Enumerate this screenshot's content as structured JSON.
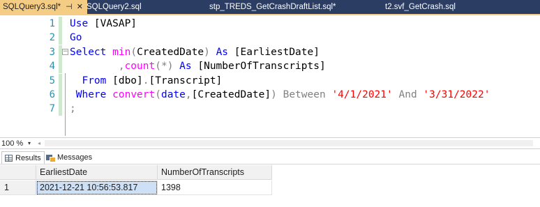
{
  "tabs": [
    {
      "label": "SQLQuery3.sql*",
      "pin": "⊣",
      "close": "✕"
    },
    {
      "label": "SQLQuery2.sql"
    },
    {
      "label": "stp_TREDS_GetCrashDraftList.sql*"
    },
    {
      "label": "t2.svf_GetCrash.sql"
    }
  ],
  "editor": {
    "line_numbers": [
      "1",
      "2",
      "3",
      "4",
      "5",
      "6",
      "7"
    ],
    "fold_marker": "−",
    "lines": [
      {
        "tokens": [
          {
            "c": "kw",
            "t": "Use"
          },
          {
            "c": "tx",
            "t": " [VASAP]"
          }
        ]
      },
      {
        "tokens": [
          {
            "c": "kw",
            "t": "Go"
          }
        ]
      },
      {
        "tokens": [
          {
            "c": "kw",
            "t": "Select"
          },
          {
            "c": "tx",
            "t": " "
          },
          {
            "c": "fn",
            "t": "min"
          },
          {
            "c": "gr",
            "t": "("
          },
          {
            "c": "tx",
            "t": "CreatedDate"
          },
          {
            "c": "gr",
            "t": ")"
          },
          {
            "c": "tx",
            "t": " "
          },
          {
            "c": "kw",
            "t": "As"
          },
          {
            "c": "tx",
            "t": " [EarliestDate]"
          }
        ]
      },
      {
        "tokens": [
          {
            "c": "tx",
            "t": "        "
          },
          {
            "c": "gr",
            "t": ","
          },
          {
            "c": "fn",
            "t": "count"
          },
          {
            "c": "gr",
            "t": "(*)"
          },
          {
            "c": "tx",
            "t": " "
          },
          {
            "c": "kw",
            "t": "As"
          },
          {
            "c": "tx",
            "t": " [NumberOfTranscripts]"
          }
        ]
      },
      {
        "tokens": [
          {
            "c": "tx",
            "t": "  "
          },
          {
            "c": "kw",
            "t": "From"
          },
          {
            "c": "tx",
            "t": " [dbo]"
          },
          {
            "c": "gr",
            "t": "."
          },
          {
            "c": "tx",
            "t": "[Transcript]"
          }
        ]
      },
      {
        "tokens": [
          {
            "c": "tx",
            "t": " "
          },
          {
            "c": "kw",
            "t": "Where"
          },
          {
            "c": "tx",
            "t": " "
          },
          {
            "c": "fn",
            "t": "convert"
          },
          {
            "c": "gr",
            "t": "("
          },
          {
            "c": "kw",
            "t": "date"
          },
          {
            "c": "gr",
            "t": ","
          },
          {
            "c": "tx",
            "t": "[CreatedDate]"
          },
          {
            "c": "gr",
            "t": ")"
          },
          {
            "c": "tx",
            "t": " "
          },
          {
            "c": "gr",
            "t": "Between"
          },
          {
            "c": "tx",
            "t": " "
          },
          {
            "c": "st",
            "t": "'4/1/2021'"
          },
          {
            "c": "tx",
            "t": " "
          },
          {
            "c": "gr",
            "t": "And"
          },
          {
            "c": "tx",
            "t": " "
          },
          {
            "c": "st",
            "t": "'3/31/2022'"
          }
        ]
      },
      {
        "tokens": [
          {
            "c": "gr",
            "t": ";"
          }
        ]
      }
    ]
  },
  "zoom": {
    "value": "100 %",
    "dropdown_icon": "chevron-down-icon",
    "dropdown_glyph": "▾",
    "scroll_left_glyph": "◂"
  },
  "results_tabs": [
    {
      "label": "Results",
      "icon": "grid-icon"
    },
    {
      "label": "Messages",
      "icon": "messages-icon"
    }
  ],
  "grid": {
    "columns": [
      "EarliestDate",
      "NumberOfTranscripts"
    ],
    "rows": [
      {
        "row_number": "1",
        "cells": [
          "2021-12-21 10:56:53.817",
          "1398"
        ]
      }
    ]
  },
  "colors": {
    "tab_strip": "#2b3d63",
    "active_tab": "#f5cc84",
    "keyword": "#0000ff",
    "function": "#ff00ff",
    "string": "#ff0000",
    "operator": "#808080",
    "line_number": "#2b91af",
    "selected_cell": "#cde0f6"
  }
}
